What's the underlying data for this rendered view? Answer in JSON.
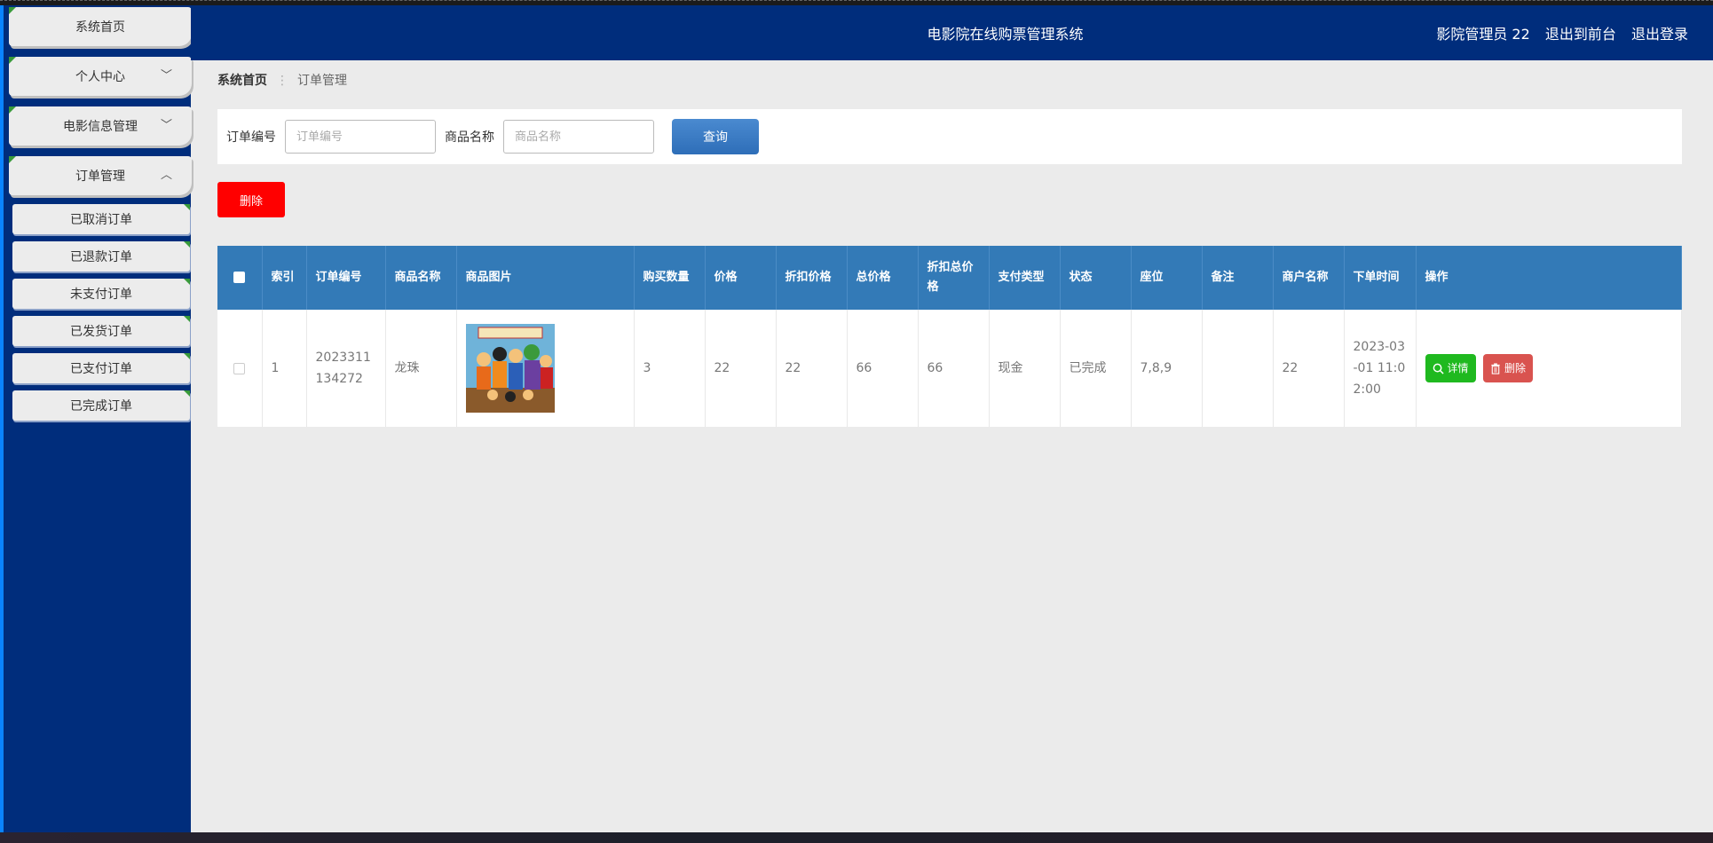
{
  "header": {
    "title": "电影院在线购票管理系统",
    "user": "影院管理员 22",
    "to_front": "退出到前台",
    "logout": "退出登录"
  },
  "sidebar": {
    "items": [
      {
        "label": "系统首页"
      },
      {
        "label": "个人中心"
      },
      {
        "label": "电影信息管理"
      },
      {
        "label": "订单管理"
      }
    ],
    "submenu": [
      {
        "label": "已取消订单"
      },
      {
        "label": "已退款订单"
      },
      {
        "label": "未支付订单"
      },
      {
        "label": "已发货订单"
      },
      {
        "label": "已支付订单"
      },
      {
        "label": "已完成订单"
      }
    ]
  },
  "breadcrumb": {
    "home": "系统首页",
    "current": "订单管理"
  },
  "search": {
    "order_no_label": "订单编号",
    "order_no_placeholder": "订单编号",
    "goods_name_label": "商品名称",
    "goods_name_placeholder": "商品名称",
    "query_button": "查询"
  },
  "toolbar": {
    "delete_button": "删除"
  },
  "table": {
    "columns": [
      "索引",
      "订单编号",
      "商品名称",
      "商品图片",
      "购买数量",
      "价格",
      "折扣价格",
      "总价格",
      "折扣总价格",
      "支付类型",
      "状态",
      "座位",
      "备注",
      "商户名称",
      "下单时间",
      "操作"
    ],
    "rows": [
      {
        "index": "1",
        "order_no": "2023311134272",
        "goods_name": "龙珠",
        "quantity": "3",
        "price": "22",
        "discount_price": "22",
        "total_price": "66",
        "discount_total": "66",
        "pay_type": "现金",
        "status": "已完成",
        "seat": "7,8,9",
        "note": "",
        "merchant": "22",
        "order_time": "2023-03-01 11:02:00",
        "detail_button": "详情",
        "delete_button": "删除"
      }
    ]
  }
}
